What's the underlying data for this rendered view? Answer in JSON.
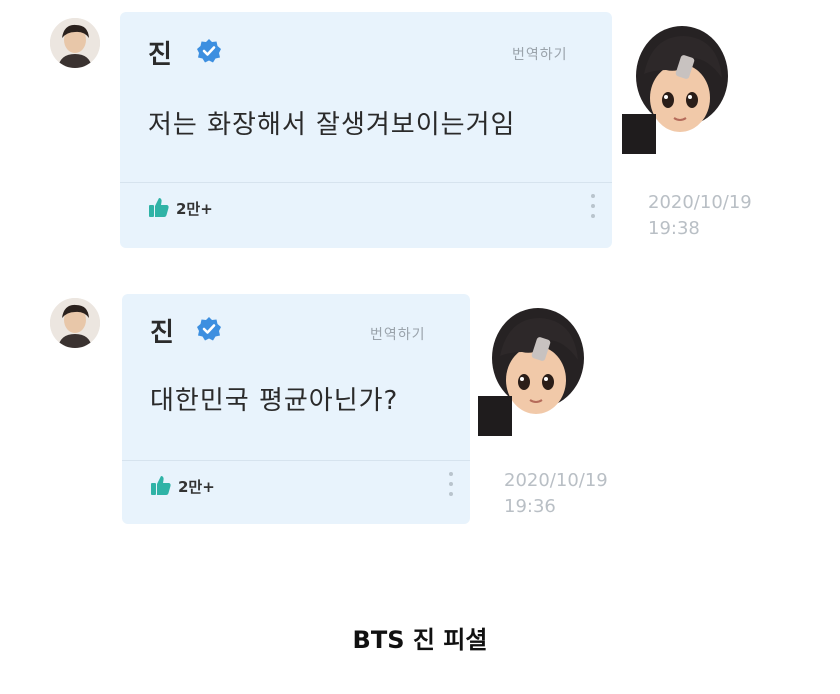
{
  "posts": [
    {
      "author": "진",
      "translate_label": "번역하기",
      "message": "저는 화장해서 잘생겨보이는거임",
      "likes": "2만+",
      "timestamp": "2020/10/19\n19:38"
    },
    {
      "author": "진",
      "translate_label": "번역하기",
      "message": "대한민국 평균아닌가?",
      "likes": "2만+",
      "timestamp": "2020/10/19\n19:36"
    }
  ],
  "caption": "BTS 진 피셜",
  "icons": {
    "verified": "verified-badge-icon",
    "like": "thumbs-up-icon",
    "more": "more-vertical-icon"
  },
  "colors": {
    "card_bg": "#e8f3fc",
    "verified_blue": "#3d8fe0",
    "like_teal": "#2fb3a6"
  }
}
